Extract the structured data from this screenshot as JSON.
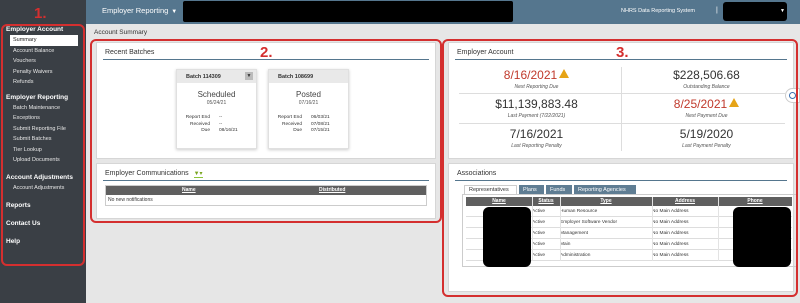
{
  "topbar": {
    "app_title": "Employer Reporting",
    "system_name": "NHRS Data Reporting System",
    "separator": "|"
  },
  "page_title": "Account Summary",
  "sidebar": {
    "sections": [
      {
        "label": "Employer Account",
        "items": [
          "Summary",
          "Account Balance",
          "Vouchers",
          "Penalty Waivers",
          "Refunds"
        ]
      },
      {
        "label": "Employer Reporting",
        "items": [
          "Batch Maintenance",
          "Exceptions",
          "Submit Reporting File",
          "Submit Batches",
          "Tier Lookup",
          "Upload Documents"
        ]
      },
      {
        "label": "Account Adjustments",
        "items": [
          "Account Adjustments"
        ]
      },
      {
        "label": "Reports",
        "items": []
      },
      {
        "label": "Contact Us",
        "items": []
      },
      {
        "label": "Help",
        "items": []
      }
    ],
    "active_item": "Summary"
  },
  "recent_batches": {
    "title": "Recent Batches",
    "batches": [
      {
        "name": "Batch 114309",
        "status": "Scheduled",
        "date": "05/24/21",
        "report_end_label": "Report End",
        "report_end": "--",
        "received_label": "Received",
        "received": "--",
        "due_label": "Due",
        "due": "08/16/21"
      },
      {
        "name": "Batch 108699",
        "status": "Posted",
        "date": "07/16/21",
        "report_end_label": "Report End",
        "report_end": "06/03/21",
        "received_label": "Received",
        "received": "07/08/21",
        "due_label": "Due",
        "due": "07/15/21"
      }
    ]
  },
  "communications": {
    "title": "Employer Communications",
    "filter_icon": "filter-icon",
    "col_name": "Name",
    "col_distributed": "Distributed",
    "empty_text": "No new notifications"
  },
  "employer_account": {
    "title": "Employer Account",
    "next_due_value": "8/16/2021",
    "next_due_label": "Next Reporting Due",
    "outstanding_value": "$228,506.68",
    "outstanding_label": "Outstanding Balance",
    "last_payment_value": "$11,139,883.48",
    "last_payment_label": "Last Payment (7/22/2021)",
    "next_payment_value": "8/25/2021",
    "next_payment_label": "Next Payment Due",
    "last_penalty_value": "7/16/2021",
    "last_penalty_label": "Last Reporting Penalty",
    "last_pay_penalty_value": "5/19/2020",
    "last_pay_penalty_label": "Last Payment Penalty",
    "alert_color": "#c0392b",
    "warning_color": "#e6a417"
  },
  "associations": {
    "title": "Associations",
    "tabs": [
      "Representatives",
      "Plans",
      "Funds",
      "Reporting Agencies"
    ],
    "active_tab": "Representatives",
    "columns": [
      "Name",
      "Status",
      "Type",
      "Address",
      "Phone"
    ],
    "rows": [
      {
        "status": "Active",
        "type": "Human Resource",
        "address": "No Main Address"
      },
      {
        "status": "Active",
        "type": "Employer Software Vendor",
        "address": "No Main Address"
      },
      {
        "status": "Active",
        "type": "Management",
        "address": "No Main Address"
      },
      {
        "status": "Active",
        "type": "Main",
        "address": "No Main Address"
      },
      {
        "status": "Active",
        "type": "Administration",
        "address": "No Main Address"
      }
    ]
  },
  "annotations": {
    "n1": "1.",
    "n2": "2.",
    "n3": "3.",
    "color": "#d42f2f"
  },
  "colors": {
    "topbar": "#55768e",
    "sidebar": "#3a3f45",
    "table_header": "#5f5f5f"
  }
}
